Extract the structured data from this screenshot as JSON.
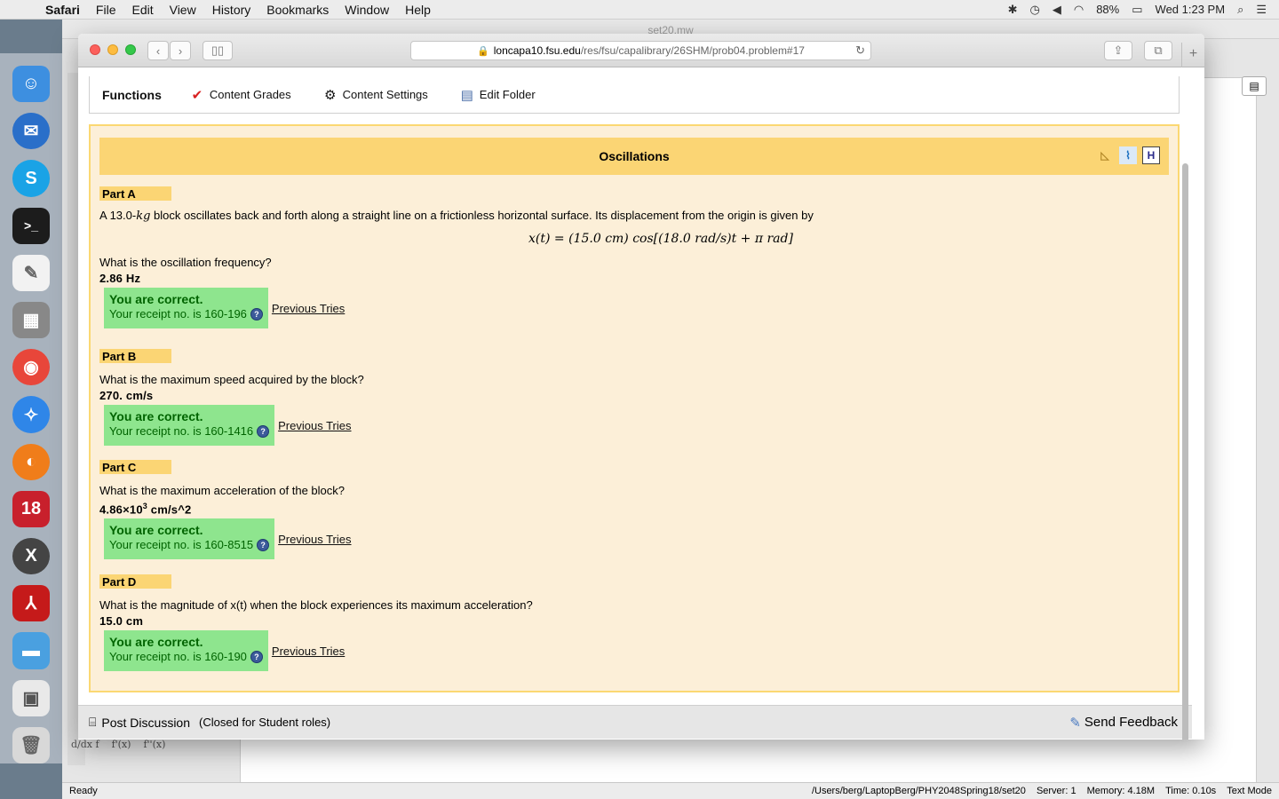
{
  "menubar": {
    "app": "Safari",
    "items": [
      "File",
      "Edit",
      "View",
      "History",
      "Bookmarks",
      "Window",
      "Help"
    ],
    "battery": "88%",
    "clock": "Wed 1:23 PM"
  },
  "bg_window": {
    "title": "set20.mw",
    "status_left": "Ready",
    "status_right": {
      "path": "/Users/berg/LaptopBerg/PHY2048Spring18/set20",
      "server": "Server: 1",
      "memory": "Memory: 4.18M",
      "time": "Time: 0.10s",
      "mode": "Text Mode"
    }
  },
  "safari": {
    "url_host": "loncapa10.fsu.edu",
    "url_path": "/res/fsu/capalibrary/26SHM/prob04.problem#17"
  },
  "functions": {
    "title": "Functions",
    "content_grades": "Content Grades",
    "content_settings": "Content Settings",
    "edit_folder": "Edit Folder"
  },
  "problem": {
    "title": "Oscillations",
    "intro_prefix": "A 13.0-",
    "intro_unit": "kg",
    "intro_suffix": " block oscillates back and forth along a straight line on a frictionless horizontal surface. Its displacement from the origin is given by",
    "equation": "x(t) = (15.0 cm) cos[(18.0 rad/s)t + π rad]",
    "parts": [
      {
        "label": "Part A",
        "question": "What is the oscillation frequency?",
        "answer": "2.86 Hz",
        "status": "You are correct.",
        "receipt": "Your receipt no. is 160-196",
        "prev": "Previous Tries"
      },
      {
        "label": "Part B",
        "question": "What is the maximum speed acquired by the block?",
        "answer": "270. cm/s",
        "status": "You are correct.",
        "receipt": "Your receipt no. is 160-1416",
        "prev": "Previous Tries"
      },
      {
        "label": "Part C",
        "question": "What is the maximum acceleration of the block?",
        "answer_base": "4.86×10",
        "answer_exp": "3",
        "answer_unit": " cm/s^2",
        "status": "You are correct.",
        "receipt": "Your receipt no. is 160-8515",
        "prev": "Previous Tries"
      },
      {
        "label": "Part D",
        "question": "What is the magnitude of x(t) when the block experiences its maximum acceleration?",
        "answer": "15.0 cm",
        "status": "You are correct.",
        "receipt": "Your receipt no. is 160-190",
        "prev": "Previous Tries"
      }
    ]
  },
  "footer": {
    "post_discussion": "Post Discussion",
    "closed": "(Closed for Student roles)",
    "send_feedback": "Send Feedback"
  }
}
